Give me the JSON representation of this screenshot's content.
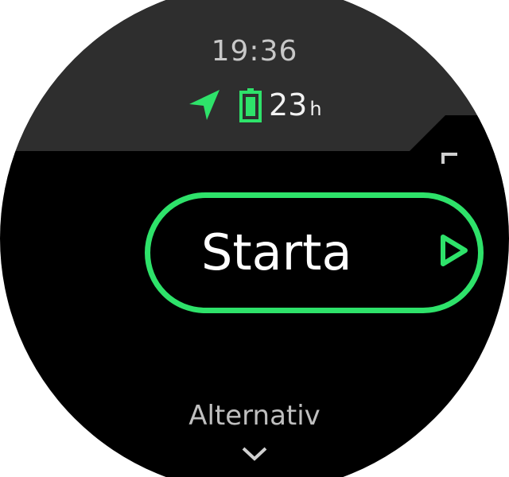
{
  "status": {
    "time": "19:36",
    "gps_icon": "location-arrow-icon",
    "battery_icon": "battery-icon",
    "battery_hours": "23",
    "battery_unit": "h"
  },
  "main": {
    "start_label": "Starta",
    "start_icon": "play-icon",
    "options_label": "Alternativ",
    "scroll_up_icon": "chevron-up-icon",
    "scroll_down_icon": "chevron-down-icon"
  },
  "colors": {
    "accent": "#2ee26a",
    "background": "#000000",
    "top_panel": "#2e2e2e"
  }
}
